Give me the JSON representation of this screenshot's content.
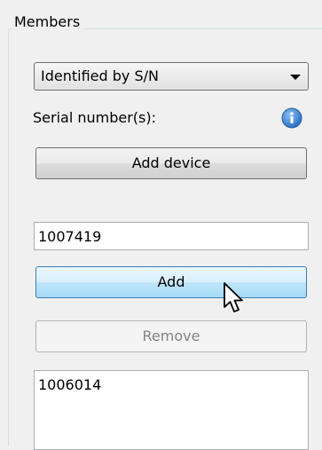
{
  "members": {
    "group_title": "Members",
    "identify_mode": "Identified by S/N",
    "serial_label": "Serial number(s):",
    "add_device_label": "Add device",
    "serial_input_value": "1007419",
    "add_label": "Add",
    "remove_label": "Remove",
    "serial_list": [
      "1006014"
    ]
  },
  "icons": {
    "info": "info-icon",
    "dropdown": "chevron-down-icon",
    "cursor": "mouse-pointer-icon"
  },
  "colors": {
    "info_icon": "#3b82d6",
    "hover_border": "#3c7fb1",
    "disabled_text": "#838383"
  }
}
